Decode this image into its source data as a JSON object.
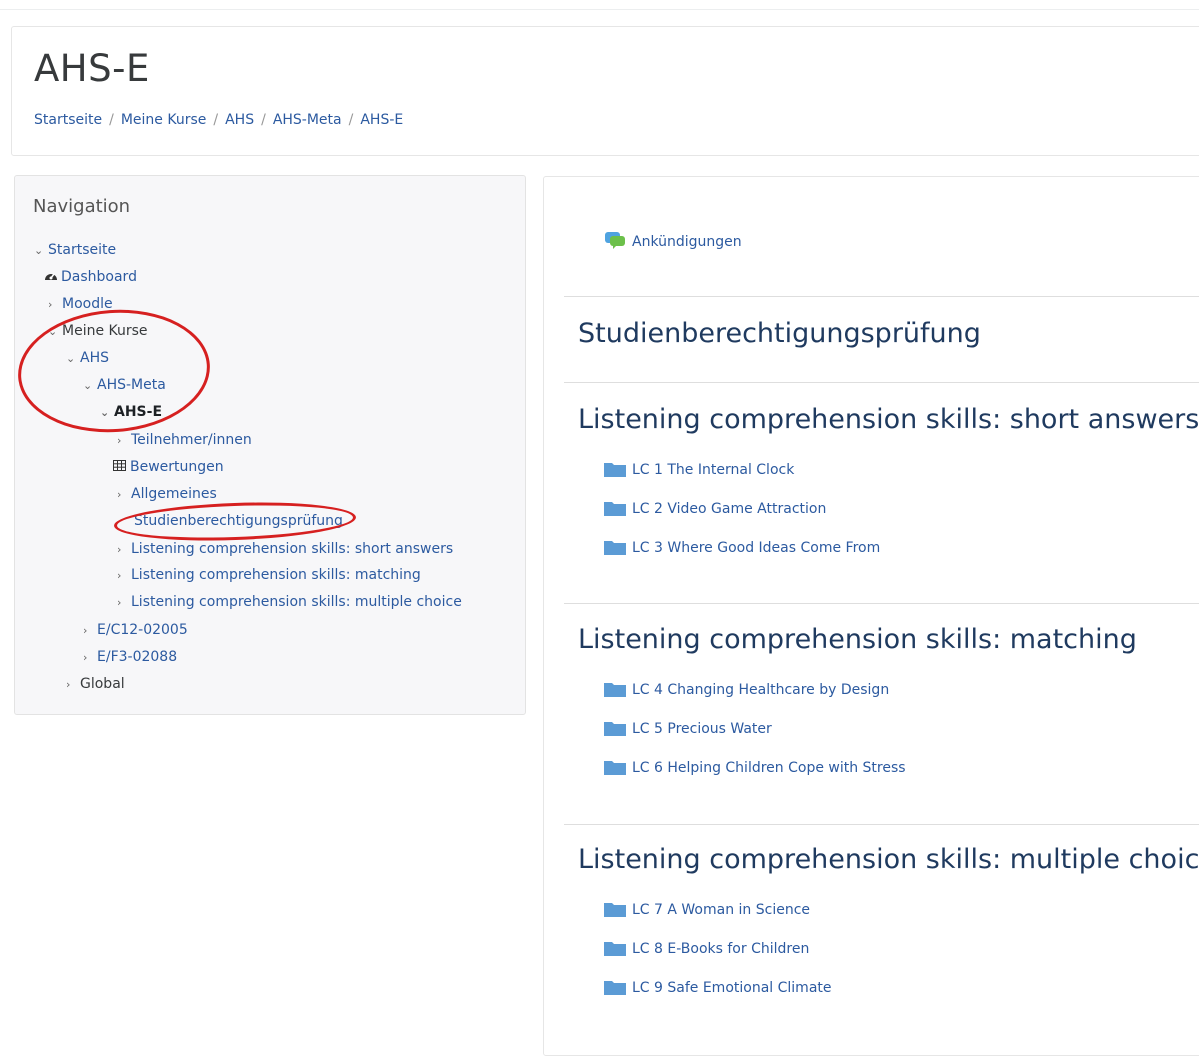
{
  "header": {
    "title": "AHS-E",
    "breadcrumb": [
      "Startseite",
      "Meine Kurse",
      "AHS",
      "AHS-Meta",
      "AHS-E"
    ],
    "separator": "/"
  },
  "navigation": {
    "title": "Navigation",
    "items": [
      {
        "label": "Startseite",
        "state": "expanded"
      },
      {
        "label": "Dashboard",
        "icon": "dashboard-icon"
      },
      {
        "label": "Moodle",
        "state": "collapsed"
      },
      {
        "label": "Meine Kurse",
        "state": "expanded"
      },
      {
        "label": "AHS",
        "state": "expanded"
      },
      {
        "label": "AHS-Meta",
        "state": "expanded"
      },
      {
        "label": "AHS-E",
        "state": "expanded",
        "current": true
      },
      {
        "label": "Teilnehmer/innen",
        "state": "collapsed"
      },
      {
        "label": "Bewertungen",
        "icon": "table-icon"
      },
      {
        "label": "Allgemeines",
        "state": "collapsed"
      },
      {
        "label": "Studienberechtigungsprüfung"
      },
      {
        "label": "Listening comprehension skills: short answers",
        "state": "collapsed"
      },
      {
        "label": "Listening comprehension skills: matching",
        "state": "collapsed"
      },
      {
        "label": "Listening comprehension skills: multiple choice",
        "state": "collapsed"
      },
      {
        "label": "E/C12-02005",
        "state": "collapsed"
      },
      {
        "label": "E/F3-02088",
        "state": "collapsed"
      },
      {
        "label": "Global",
        "state": "collapsed"
      }
    ]
  },
  "content": {
    "announcements": {
      "label": "Ankündigungen",
      "icon": "forum-icon"
    },
    "sections": [
      {
        "title": "Studienberechtigungsprüfung",
        "activities": []
      },
      {
        "title": "Listening comprehension skills: short answers",
        "activities": [
          "LC 1 The Internal Clock",
          "LC 2 Video Game Attraction",
          "LC 3 Where Good Ideas Come From"
        ]
      },
      {
        "title": "Listening comprehension skills: matching",
        "activities": [
          "LC 4 Changing Healthcare by Design",
          "LC 5 Precious Water",
          "LC 6 Helping Children Cope with Stress"
        ]
      },
      {
        "title": "Listening comprehension skills: multiple choice",
        "activities": [
          "LC 7 A Woman in Science",
          "LC 8 E-Books for Children",
          "LC 9 Safe Emotional Climate"
        ]
      }
    ]
  },
  "colors": {
    "link": "#2c5aa0",
    "section_title": "#1f3a5f",
    "annotation": "#d62020",
    "folder": "#5b9bd5"
  }
}
